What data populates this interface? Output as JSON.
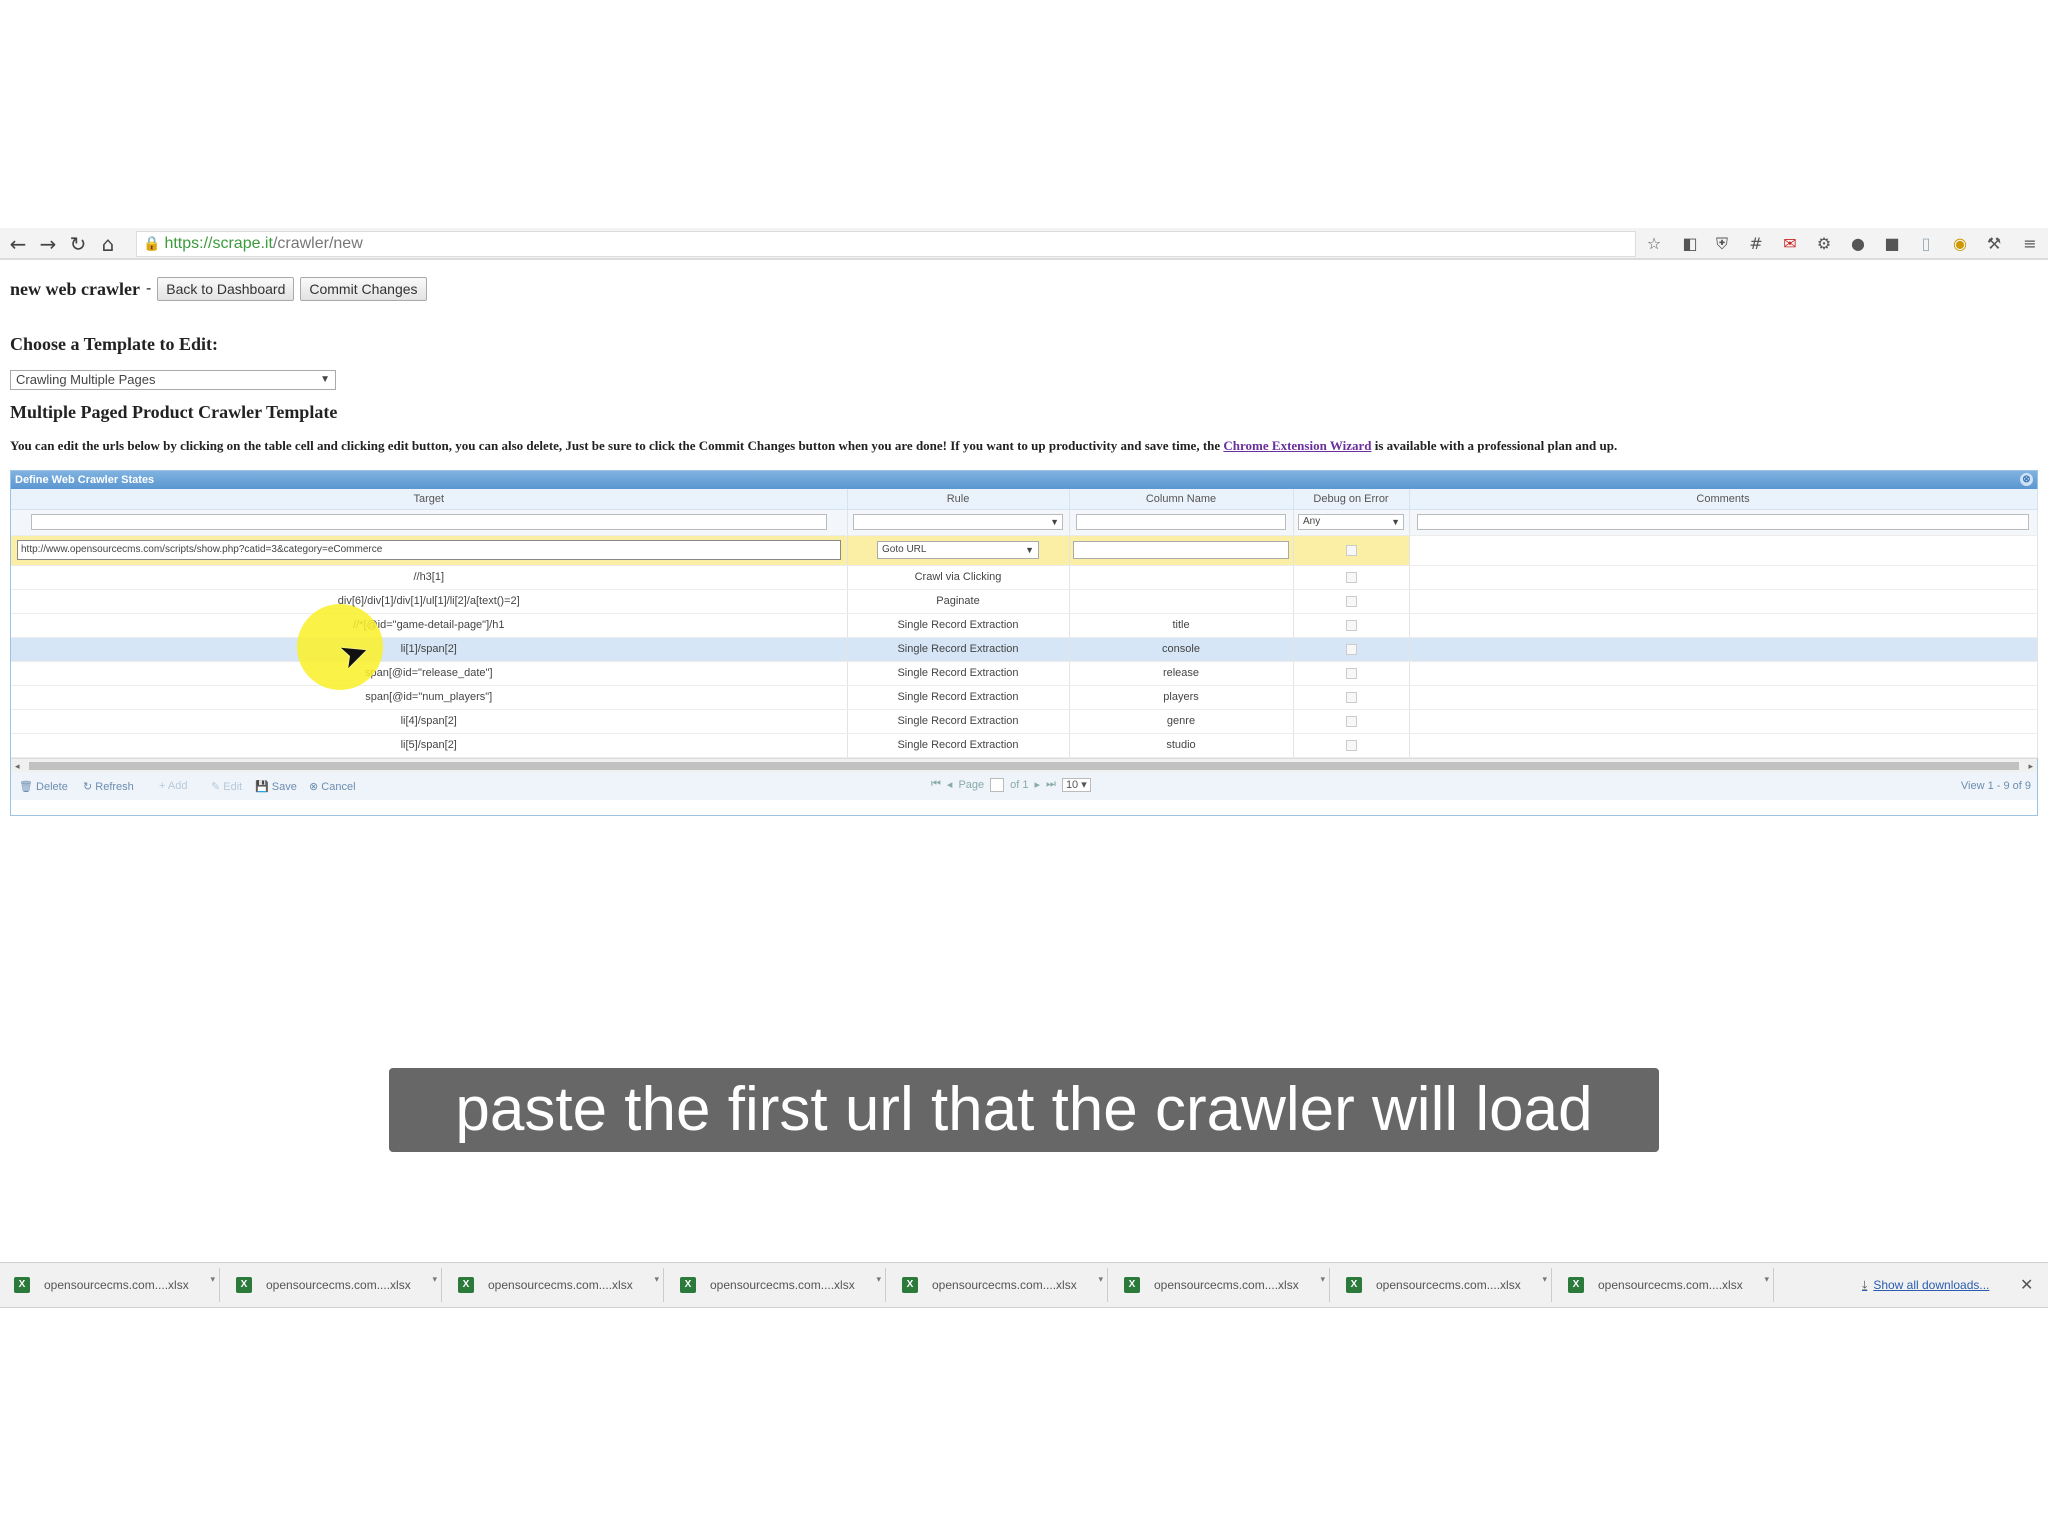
{
  "browser": {
    "url_secure": "https://scrape.it",
    "url_path": "/crawler/new"
  },
  "header": {
    "app_title": "new web crawler",
    "separator": "-",
    "back_label": "Back to Dashboard",
    "commit_label": "Commit Changes"
  },
  "template": {
    "choose_label": "Choose a Template to Edit:",
    "selected": "Crawling Multiple Pages",
    "title": "Multiple Paged Product Crawler Template",
    "instructions_pre": "You can edit the urls below by clicking on the table cell and clicking edit button, you can also delete, Just be sure to click the Commit Changes button when you are done! If you want to up productivity and save time, the",
    "link_text": "Chrome Extension Wizard",
    "instructions_post": "is available with a professional plan and up."
  },
  "grid": {
    "caption": "Define Web Crawler States",
    "columns": [
      "Target",
      "Rule",
      "Column Name",
      "Debug on Error",
      "Comments"
    ],
    "filter_debug": "Any",
    "edit_row": {
      "target": "http://www.opensourcecms.com/scripts/show.php?catid=3&category=eCommerce",
      "rule": "Goto URL"
    },
    "rows": [
      {
        "target": "//h3[1]",
        "rule": "Crawl via Clicking",
        "column": ""
      },
      {
        "target": "div[6]/div[1]/div[1]/ul[1]/li[2]/a[text()=2]",
        "rule": "Paginate",
        "column": ""
      },
      {
        "target": "//*[@id=\"game-detail-page\"]/h1",
        "rule": "Single Record Extraction",
        "column": "title"
      },
      {
        "target": "li[1]/span[2]",
        "rule": "Single Record Extraction",
        "column": "console"
      },
      {
        "target": "span[@id=\"release_date\"]",
        "rule": "Single Record Extraction",
        "column": "release"
      },
      {
        "target": "span[@id=\"num_players\"]",
        "rule": "Single Record Extraction",
        "column": "players"
      },
      {
        "target": "li[4]/span[2]",
        "rule": "Single Record Extraction",
        "column": "genre"
      },
      {
        "target": "li[5]/span[2]",
        "rule": "Single Record Extraction",
        "column": "studio"
      }
    ],
    "pager": {
      "delete": "Delete",
      "refresh": "Refresh",
      "add": "Add",
      "edit": "Edit",
      "save": "Save",
      "cancel": "Cancel",
      "page_label": "Page",
      "of_label": "of 1",
      "page_size": "10",
      "view_text": "View 1 - 9 of 9"
    }
  },
  "caption": "paste the first url that the crawler will load",
  "downloads": {
    "items": [
      "opensourcecms.com....xlsx",
      "opensourcecms.com....xlsx",
      "opensourcecms.com....xlsx",
      "opensourcecms.com....xlsx",
      "opensourcecms.com....xlsx",
      "opensourcecms.com....xlsx",
      "opensourcecms.com....xlsx",
      "opensourcecms.com....xlsx"
    ],
    "show_all": "Show all downloads..."
  }
}
